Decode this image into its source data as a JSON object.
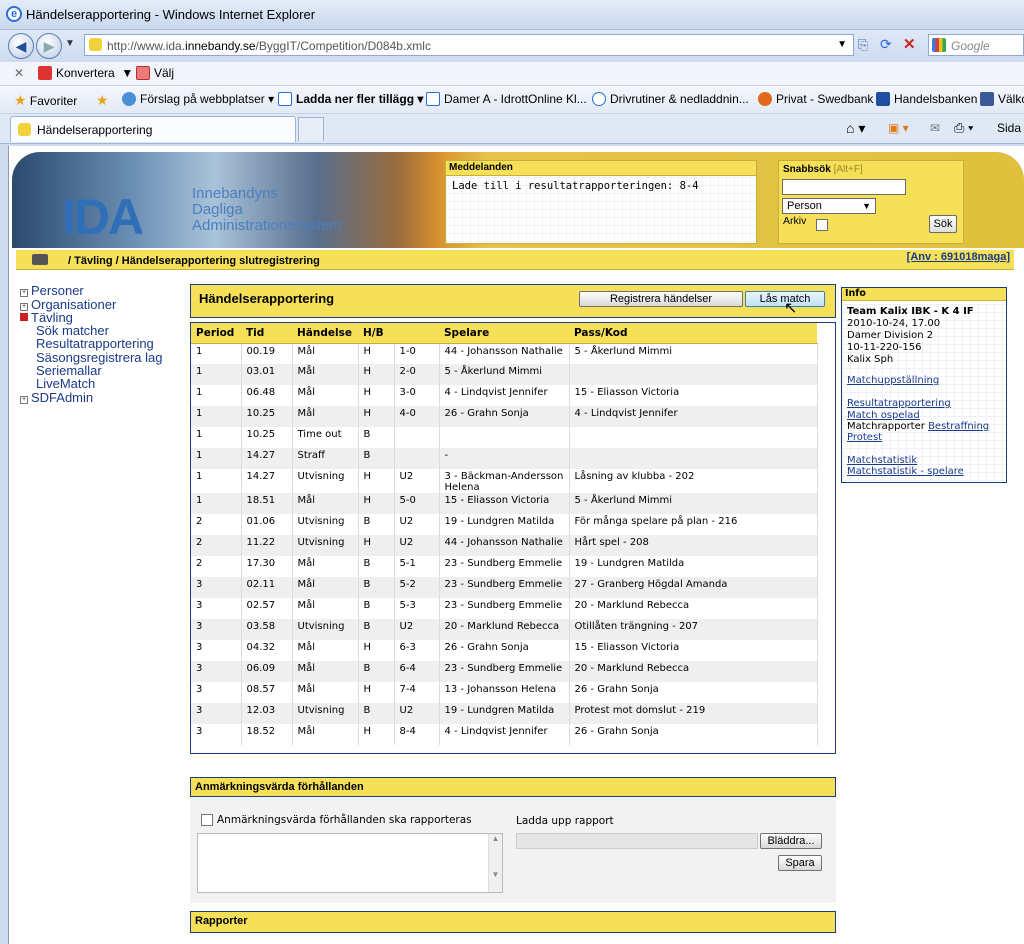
{
  "browser": {
    "window_title": "Händelserapportering - Windows Internet Explorer",
    "url_prefix": "http://www.ida.",
    "url_domain": "innebandy.se",
    "url_path": "/ByggIT/Competition/D084b.xmlc",
    "search_placeholder": "Google",
    "cmd_convert": "Konvertera",
    "cmd_select": "Välj",
    "favorites_label": "Favoriter",
    "favorites": [
      "Förslag på webbplatser",
      "Ladda ner fler tillägg",
      "Damer A - IdrottOnline Kl...",
      "Drivrutiner & nedladdnin...",
      "Privat - Swedbank",
      "Handelsbanken",
      "Välko"
    ],
    "tab_title": "Händelserapportering",
    "page_menu": "Sida"
  },
  "banner": {
    "logo": "IDA",
    "subtitle_lines": [
      "Innebandyns",
      "Dagliga",
      "Administrationssystem"
    ],
    "messages_title": "Meddelanden",
    "message": "Lade till i resultatrapporteringen: 8-4",
    "quicksearch_title": "Snabbsök",
    "quicksearch_hint": "[Alt+F]",
    "quicksearch_type": "Person",
    "archive_label": "Arkiv",
    "search_button": "Sök"
  },
  "breadcrumb": {
    "path": "/ Tävling / Händelserapportering slutregistrering",
    "user": "[Anv : 691018maga]"
  },
  "sidebar": [
    {
      "label": "Personer",
      "level": 0,
      "box": "+"
    },
    {
      "label": "Organisationer",
      "level": 0,
      "box": "+"
    },
    {
      "label": "Tävling",
      "level": 0,
      "box": "-"
    },
    {
      "label": "Sök matcher",
      "level": 1
    },
    {
      "label": "Resultatrapportering",
      "level": 1
    },
    {
      "label": "Säsongsregistrera lag",
      "level": 1
    },
    {
      "label": "Seriemallar",
      "level": 1
    },
    {
      "label": "LiveMatch",
      "level": 1
    },
    {
      "label": "SDFAdmin",
      "level": 0,
      "box": "+"
    }
  ],
  "main": {
    "title": "Händelserapportering",
    "register_button": "Registrera händelser",
    "lock_button": "Lås match",
    "columns": [
      "Period",
      "Tid",
      "Händelse",
      "H/B",
      "",
      "Spelare",
      "Pass/Kod"
    ],
    "rows": [
      [
        "1",
        "00.19",
        "Mål",
        "H",
        "1-0",
        "44 - Johansson Nathalie",
        "5 - Åkerlund Mimmi"
      ],
      [
        "1",
        "03.01",
        "Mål",
        "H",
        "2-0",
        "5 - Åkerlund Mimmi",
        ""
      ],
      [
        "1",
        "06.48",
        "Mål",
        "H",
        "3-0",
        "4 - Lindqvist Jennifer",
        "15 - Eliasson Victoria"
      ],
      [
        "1",
        "10.25",
        "Mål",
        "H",
        "4-0",
        "26 - Grahn Sonja",
        "4 - Lindqvist Jennifer"
      ],
      [
        "1",
        "10.25",
        "Time out",
        "B",
        "",
        "",
        ""
      ],
      [
        "1",
        "14.27",
        "Straff",
        "B",
        "",
        "-",
        ""
      ],
      [
        "1",
        "14.27",
        "Utvisning",
        "H",
        "U2",
        "3 - Bäckman-Andersson Helena",
        "Låsning av klubba - 202"
      ],
      [
        "1",
        "18.51",
        "Mål",
        "H",
        "5-0",
        "15 - Eliasson Victoria",
        "5 - Åkerlund Mimmi"
      ],
      [
        "2",
        "01.06",
        "Utvisning",
        "B",
        "U2",
        "19 - Lundgren Matilda",
        "För många spelare på plan - 216"
      ],
      [
        "2",
        "11.22",
        "Utvisning",
        "H",
        "U2",
        "44 - Johansson Nathalie",
        "Hårt spel - 208"
      ],
      [
        "2",
        "17.30",
        "Mål",
        "B",
        "5-1",
        "23 - Sundberg Emmelie",
        "19 - Lundgren Matilda"
      ],
      [
        "3",
        "02.11",
        "Mål",
        "B",
        "5-2",
        "23 - Sundberg Emmelie",
        "27 - Granberg Högdal Amanda"
      ],
      [
        "3",
        "02.57",
        "Mål",
        "B",
        "5-3",
        "23 - Sundberg Emmelie",
        "20 - Marklund Rebecca"
      ],
      [
        "3",
        "03.58",
        "Utvisning",
        "B",
        "U2",
        "20 - Marklund Rebecca",
        "Otillåten trängning - 207"
      ],
      [
        "3",
        "04.32",
        "Mål",
        "H",
        "6-3",
        "26 - Grahn Sonja",
        "15 - Eliasson Victoria"
      ],
      [
        "3",
        "06.09",
        "Mål",
        "B",
        "6-4",
        "23 - Sundberg Emmelie",
        "20 - Marklund Rebecca"
      ],
      [
        "3",
        "08.57",
        "Mål",
        "H",
        "7-4",
        "13 - Johansson Helena",
        "26 - Grahn Sonja"
      ],
      [
        "3",
        "12.03",
        "Utvisning",
        "B",
        "U2",
        "19 - Lundgren Matilda",
        "Protest mot domslut - 219"
      ],
      [
        "3",
        "18.52",
        "Mål",
        "H",
        "8-4",
        "4 - Lindqvist Jennifer",
        "26 - Grahn Sonja"
      ]
    ]
  },
  "conditions": {
    "title": "Anmärkningsvärda förhållanden",
    "checkbox_label": "Anmärkningsvärda förhållanden ska rapporteras",
    "upload_label": "Ladda upp rapport",
    "browse_button": "Bläddra...",
    "save_button": "Spara"
  },
  "reports": {
    "title": "Rapporter"
  },
  "info": {
    "title": "Info",
    "team": "Team Kalix IBK - K 4 IF",
    "datetime": "2010-10-24, 17.00",
    "division": "Damer Division 2",
    "match_id": "10-11-220-156",
    "venue": "Kalix Sph",
    "link_lineup": "Matchuppställning",
    "link_result": "Resultatrapportering",
    "link_unplayed": "Match ospelad",
    "match_reports_label": "Matchrapporter",
    "link_penalty": "Bestraffning",
    "link_protest": "Protest",
    "link_stats": "Matchstatistik",
    "link_player_stats": "Matchstatistik - spelare"
  }
}
